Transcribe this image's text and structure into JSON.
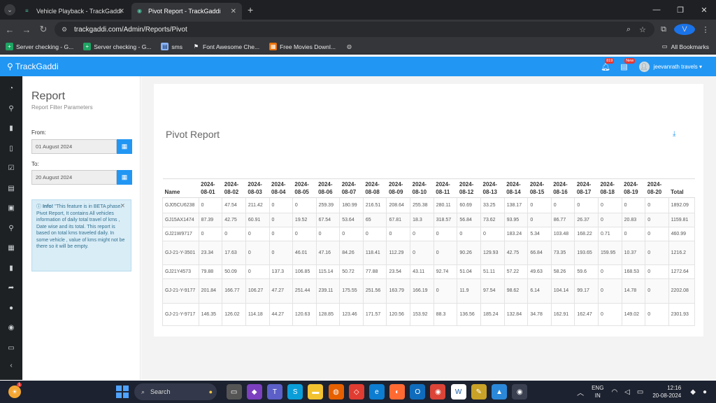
{
  "browser": {
    "tabs": [
      {
        "title": "Vehicle Playback - TrackGaddi",
        "active": false
      },
      {
        "title": "Pivot Report - TrackGaddi",
        "active": true
      }
    ],
    "url": "trackgaddi.com/Admin/Reports/Pivot",
    "profile_initial": "V",
    "bookmarks": [
      {
        "label": "Server checking - G...",
        "icon": "sheets-icon"
      },
      {
        "label": "Server checking - G...",
        "icon": "sheets-icon"
      },
      {
        "label": "sms",
        "icon": "page-icon"
      },
      {
        "label": "Font Awesome Che...",
        "icon": "flag-icon"
      },
      {
        "label": "Free Movies Downl...",
        "icon": "film-icon"
      }
    ],
    "all_bookmarks": "All Bookmarks"
  },
  "app": {
    "brand": "TrackGaddi",
    "notification_count": "819",
    "new_badge": "New",
    "user": "jeevanrath travels"
  },
  "filter": {
    "title": "Report",
    "subtitle": "Report Filter Parameters",
    "from_label": "From:",
    "from_value": "01 August 2024",
    "to_label": "To:",
    "to_value": "20 August 2024",
    "info_heading": "Info!",
    "info_text": "\"This feature is in BETA phase.\" Pivot Report, It contains All vehicles information of daily total travel of kms , Date wise and its total. This report is based on total kms traveled daily. In some vehicle , value of kms might not be there so it will be empty."
  },
  "report": {
    "title": "Pivot Report",
    "columns": [
      "Name",
      "2024-08-01",
      "2024-08-02",
      "2024-08-03",
      "2024-08-04",
      "2024-08-05",
      "2024-08-06",
      "2024-08-07",
      "2024-08-08",
      "2024-08-09",
      "2024-08-10",
      "2024-08-11",
      "2024-08-12",
      "2024-08-13",
      "2024-08-14",
      "2024-08-15",
      "2024-08-16",
      "2024-08-17",
      "2024-08-18",
      "2024-08-19",
      "2024-08-20",
      "Total"
    ],
    "rows": [
      [
        "GJ05CU6238",
        "0",
        "47.54",
        "211.42",
        "0",
        "0",
        "259.39",
        "180.99",
        "216.51",
        "208.64",
        "255.38",
        "280.11",
        "60.69",
        "33.25",
        "138.17",
        "0",
        "0",
        "0",
        "0",
        "0",
        "0",
        "1892.09"
      ],
      [
        "GJ15AX1474",
        "87.39",
        "42.75",
        "60.91",
        "0",
        "19.52",
        "67.54",
        "53.64",
        "65",
        "67.81",
        "18.3",
        "318.57",
        "56.84",
        "73.62",
        "93.95",
        "0",
        "86.77",
        "26.37",
        "0",
        "20.83",
        "0",
        "1159.81"
      ],
      [
        "GJ21W9717",
        "0",
        "0",
        "0",
        "0",
        "0",
        "0",
        "0",
        "0",
        "0",
        "0",
        "0",
        "0",
        "0",
        "183.24",
        "5.34",
        "103.48",
        "168.22",
        "0.71",
        "0",
        "0",
        "460.99"
      ],
      [
        "GJ-21-Y-3501",
        "23.34",
        "17.63",
        "0",
        "0",
        "46.01",
        "47.16",
        "84.26",
        "118.41",
        "112.29",
        "0",
        "0",
        "90.26",
        "129.93",
        "42.75",
        "66.84",
        "73.35",
        "193.65",
        "159.95",
        "10.37",
        "0",
        "1216.2"
      ],
      [
        "GJ21Y4573",
        "79.88",
        "50.09",
        "0",
        "137.3",
        "106.85",
        "115.14",
        "50.72",
        "77.88",
        "23.54",
        "43.11",
        "92.74",
        "51.04",
        "51.11",
        "57.22",
        "49.63",
        "58.26",
        "59.6",
        "0",
        "168.53",
        "0",
        "1272.64"
      ],
      [
        "GJ-21-Y-9177",
        "201.84",
        "166.77",
        "106.27",
        "47.27",
        "251.44",
        "239.11",
        "175.55",
        "251.56",
        "163.79",
        "166.19",
        "0",
        "11.9",
        "97.54",
        "98.62",
        "6.14",
        "104.14",
        "99.17",
        "0",
        "14.78",
        "0",
        "2202.08"
      ],
      [
        "GJ-21-Y-9717",
        "146.35",
        "126.02",
        "114.18",
        "44.27",
        "120.63",
        "128.85",
        "123.46",
        "171.57",
        "120.56",
        "153.92",
        "88.3",
        "136.56",
        "185.24",
        "132.84",
        "34.78",
        "162.91",
        "162.47",
        "0",
        "149.02",
        "0",
        "2301.93"
      ]
    ]
  },
  "taskbar": {
    "search_placeholder": "Search",
    "weather_badge": "1",
    "lang_line1": "ENG",
    "lang_line2": "IN",
    "time": "12:16",
    "date": "20-08-2024"
  }
}
